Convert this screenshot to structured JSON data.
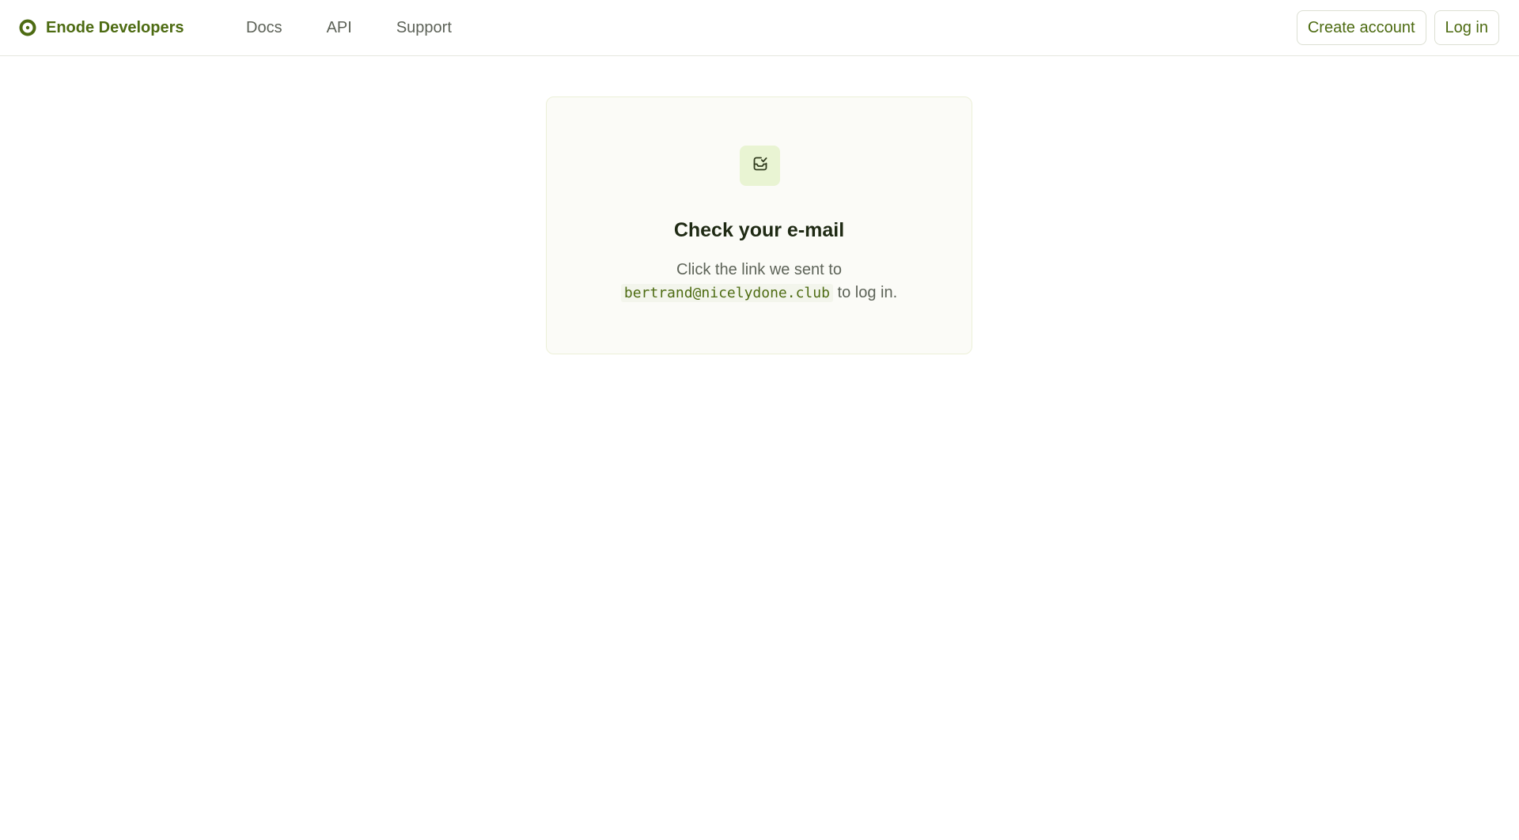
{
  "brand": {
    "name": "Enode Developers",
    "logo_icon": "enode-logo-icon",
    "color": "#4d6b12"
  },
  "nav": {
    "items": [
      {
        "label": "Docs"
      },
      {
        "label": "API"
      },
      {
        "label": "Support"
      }
    ]
  },
  "actions": {
    "create_account_label": "Create account",
    "login_label": "Log in"
  },
  "card": {
    "icon": "inbox-check-icon",
    "title": "Check your e-mail",
    "message_prefix": "Click the link we sent to",
    "email": "bertrand@nicelydone.club",
    "message_suffix": "to log in."
  },
  "colors": {
    "accent": "#4d6b12",
    "icon_tile": "#e9f4d3",
    "card_background": "#fbfbf7"
  }
}
